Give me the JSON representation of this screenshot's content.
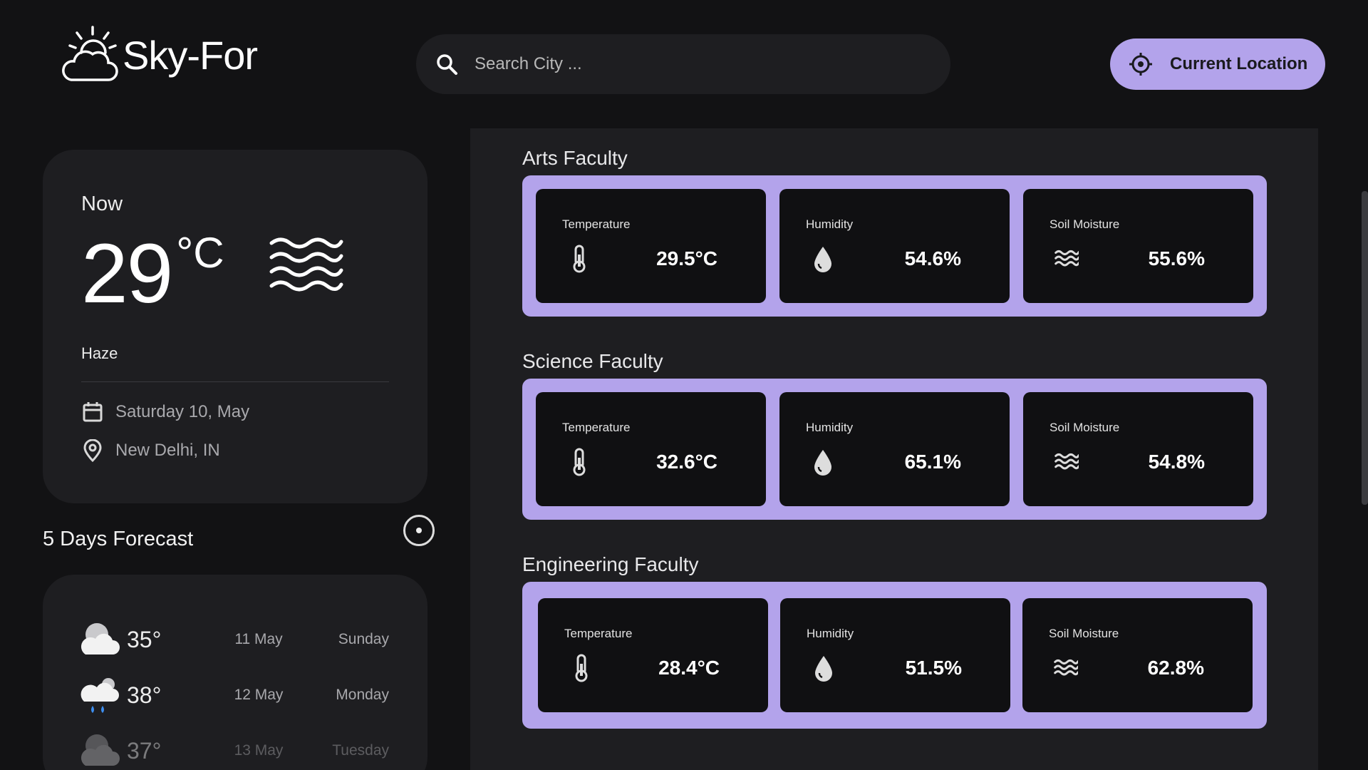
{
  "header": {
    "app_name": "Sky-For",
    "search_placeholder": "Search City ...",
    "location_button": "Current Location"
  },
  "now": {
    "label": "Now",
    "temperature": "29",
    "unit": "°C",
    "condition": "Haze",
    "date": "Saturday 10, May",
    "location": "New Delhi, IN"
  },
  "forecast": {
    "title": "5 Days Forecast",
    "days": [
      {
        "temp": "35°",
        "date": "11 May",
        "day": "Sunday",
        "icon": "cloudy-icon"
      },
      {
        "temp": "38°",
        "date": "12 May",
        "day": "Monday",
        "icon": "rain-cloud-icon"
      },
      {
        "temp": "37°",
        "date": "13 May",
        "day": "Tuesday",
        "icon": "cloudy-icon"
      }
    ]
  },
  "faculties": [
    {
      "name": "Arts Faculty",
      "temperature": "29.5°C",
      "humidity": "54.6%",
      "soil": "55.6%"
    },
    {
      "name": "Science Faculty",
      "temperature": "32.6°C",
      "humidity": "65.1%",
      "soil": "54.8%"
    },
    {
      "name": "Engineering Faculty",
      "temperature": "28.4°C",
      "humidity": "51.5%",
      "soil": "62.8%"
    }
  ],
  "metric_labels": {
    "temperature": "Temperature",
    "humidity": "Humidity",
    "soil": "Soil Moisture"
  },
  "colors": {
    "accent": "#b3a3eb",
    "background": "#121214",
    "card": "#1e1e21",
    "metric_card": "#101012"
  }
}
